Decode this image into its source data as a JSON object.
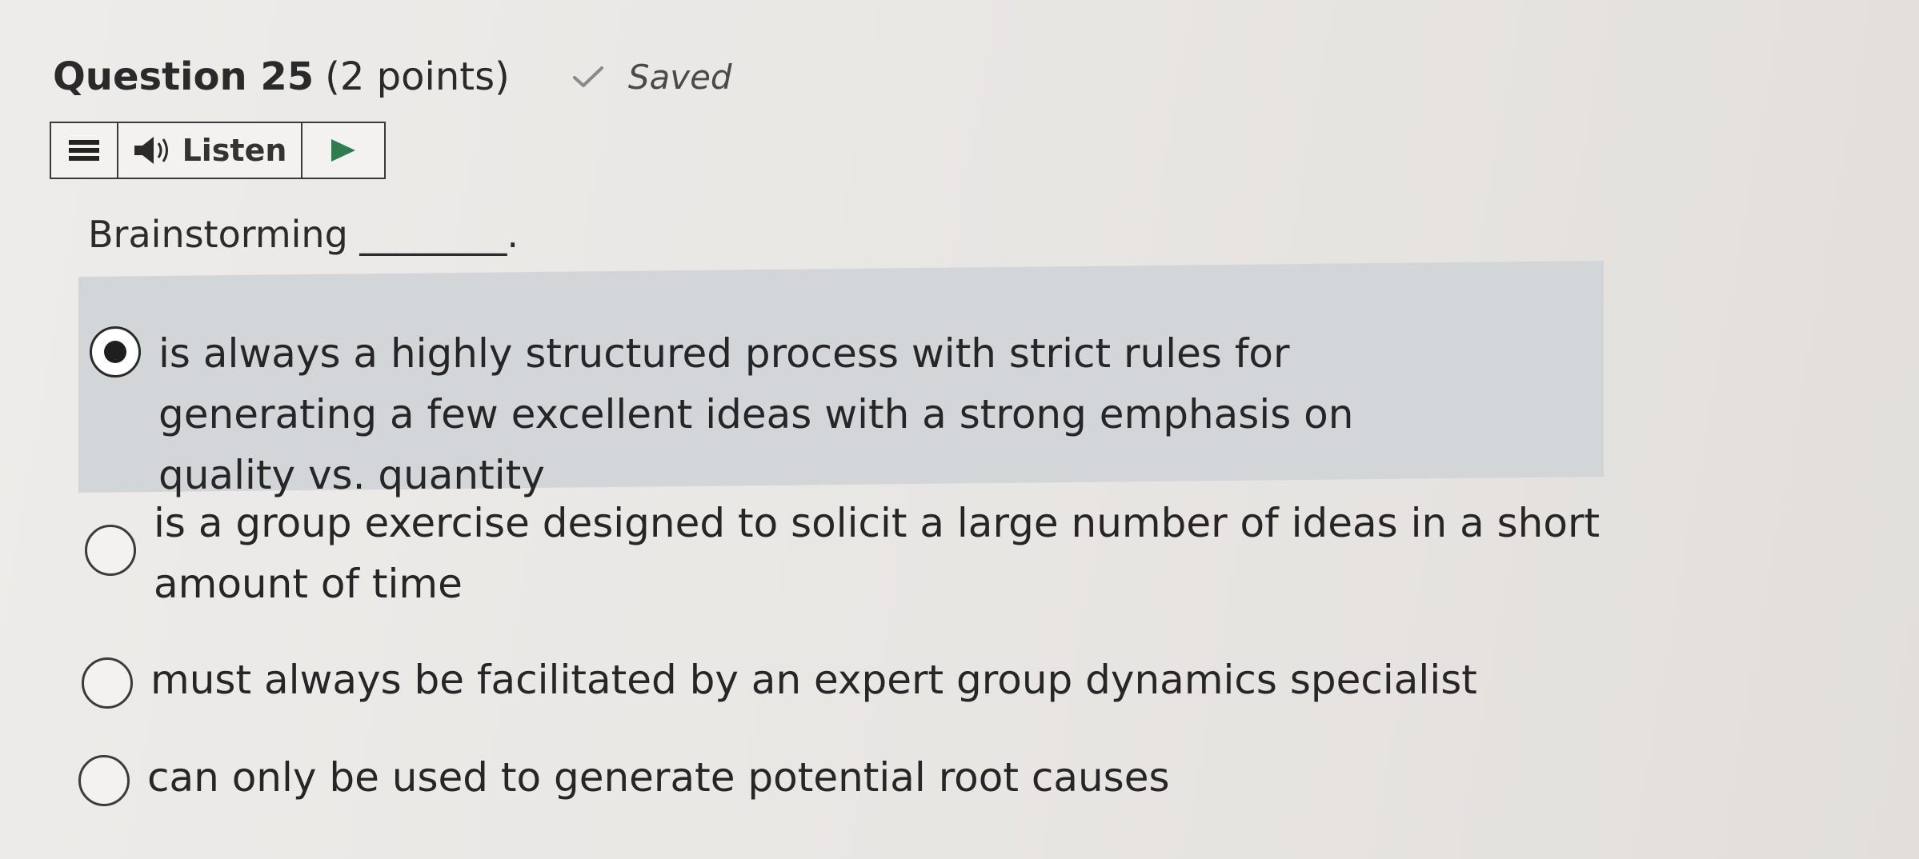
{
  "question": {
    "title": "Question 25",
    "points": "(2 points)",
    "status": "Saved"
  },
  "listen_bar": {
    "label": "Listen",
    "icons": [
      "menu-icon",
      "speaker-icon",
      "play-icon"
    ]
  },
  "prompt": "Brainstorming ________.",
  "options": [
    {
      "text": "is always a highly structured process with strict rules for generating a few excellent ideas with a strong emphasis on quality vs. quantity",
      "selected": true
    },
    {
      "text": "is a group exercise designed to solicit a large number of ideas in a short amount of time",
      "selected": false
    },
    {
      "text": "must always be facilitated by an expert group dynamics specialist",
      "selected": false
    },
    {
      "text": "can only be used to generate potential root causes",
      "selected": false
    }
  ],
  "colors": {
    "selected_background": "#d3d6d8",
    "play_accent": "#2e7d4f"
  }
}
